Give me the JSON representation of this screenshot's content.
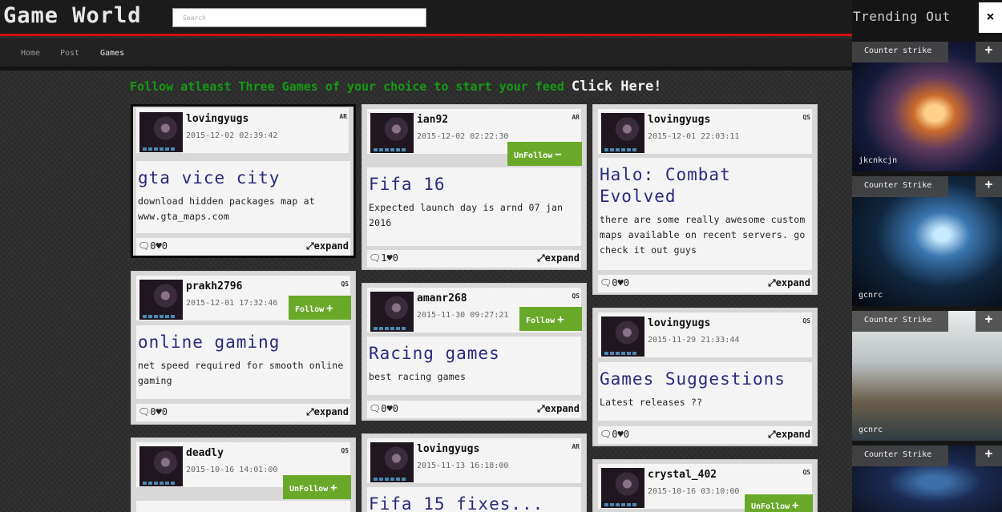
{
  "header": {
    "logo": "Game World",
    "search_placeholder": "Search",
    "nav": [
      "Home",
      "Post",
      "Games"
    ]
  },
  "banner": {
    "text": "Follow atleast Three Games of your choice to start your feed",
    "link": "Click Here!"
  },
  "colors": {
    "accent_red": "#d01010",
    "title_blue": "#2b2a7e",
    "follow_green": "#6aa82a",
    "banner_green": "#169a16"
  },
  "posts": [
    {
      "user": "lovingyugs",
      "time": "2015-12-02 02:39:42",
      "tag": "AR",
      "title": "gta vice city",
      "desc": "download hidden packages map at www.gta_maps.com",
      "comments": "0",
      "likes": "0",
      "expand": "expand",
      "selected": true
    },
    {
      "user": "ian92",
      "time": "2015-12-02 02:22:30",
      "tag": "AR",
      "title": "Fifa 16",
      "desc": "Expected launch day is arnd 07 jan 2016",
      "comments": "1",
      "likes": "0",
      "expand": "expand",
      "button": "UnFollow",
      "button_sign": "−"
    },
    {
      "user": "lovingyugs",
      "time": "2015-12-01 22:03:11",
      "tag": "QS",
      "title": "Halo: Combat Evolved",
      "desc": "there are some really awesome custom maps available on recent servers. go check it out guys",
      "comments": "0",
      "likes": "0",
      "expand": "expand"
    },
    {
      "user": "prakh2796",
      "time": "2015-12-01 17:32:46",
      "tag": "QS",
      "title": "online gaming",
      "desc": "net speed required for smooth online gaming",
      "comments": "0",
      "likes": "0",
      "expand": "expand",
      "button": "Follow",
      "button_sign": "+"
    },
    {
      "user": "amanr268",
      "time": "2015-11-30 09:27:21",
      "tag": "QS",
      "title": "Racing games",
      "desc": "best racing games",
      "comments": "0",
      "likes": "0",
      "expand": "expand",
      "button": "Follow",
      "button_sign": "+"
    },
    {
      "user": "lovingyugs",
      "time": "2015-11-29 21:33:44",
      "tag": "QS",
      "title": "Games Suggestions",
      "desc": "Latest releases ??",
      "comments": "0",
      "likes": "0",
      "expand": "expand"
    },
    {
      "user": "deadly",
      "time": "2015-10-16 14:01:00",
      "tag": "QS",
      "button": "UnFollow",
      "button_sign": "+"
    },
    {
      "user": "lovingyugs",
      "time": "2015-11-13 16:18:00",
      "tag": "AR",
      "title": "Fifa 15 fixes..."
    },
    {
      "user": "crystal_402",
      "time": "2015-10-16 03:10:00",
      "tag": "QS",
      "button": "UnFollow",
      "button_sign": "+"
    }
  ],
  "trending": {
    "title": "Trending Out",
    "close": "×",
    "items": [
      {
        "label": "Counter strike",
        "caption": "jkcnkcjn",
        "plus": "+"
      },
      {
        "label": "Counter Strike",
        "caption": "gcnrc",
        "plus": "+"
      },
      {
        "label": "Counter Strike",
        "caption": "gcnrc",
        "plus": "+"
      },
      {
        "label": "Counter Strike",
        "caption": "",
        "plus": "+"
      }
    ]
  }
}
